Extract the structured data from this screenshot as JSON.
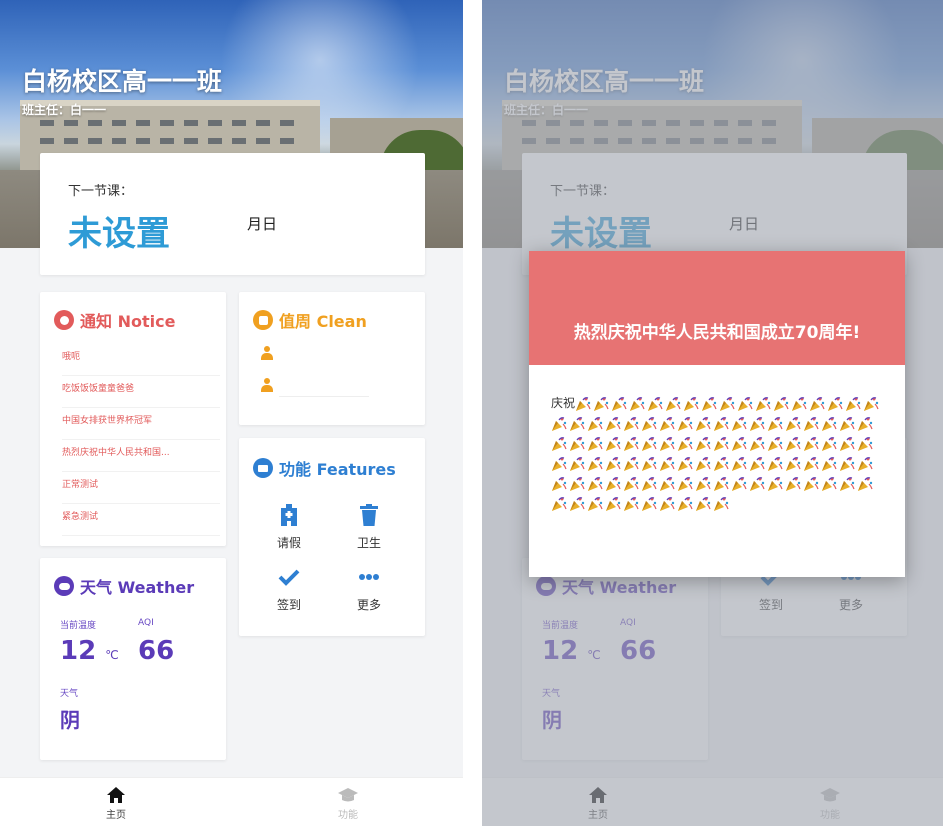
{
  "header": {
    "school_title": "白杨校区高一一班",
    "teacher": "班主任：白一一"
  },
  "next_class": {
    "label": "下一节课：",
    "value": "未设置",
    "date": "月日"
  },
  "notice": {
    "title": "通知 Notice",
    "color": "#e25b5b",
    "items": [
      "哦呃",
      "吃饭饭饭童童爸爸",
      "中国女排获世界杯冠军",
      "热烈庆祝中华人民共和国...",
      "正常测试",
      "紧急测试"
    ]
  },
  "clean": {
    "title": "值周 Clean",
    "color": "#f0a020"
  },
  "features": {
    "title": "功能 Features",
    "color": "#2e7fd2",
    "items": [
      {
        "label": "请假",
        "icon": "hospital-icon"
      },
      {
        "label": "卫生",
        "icon": "trash-icon"
      },
      {
        "label": "签到",
        "icon": "check-icon"
      },
      {
        "label": "更多",
        "icon": "more-icon"
      }
    ]
  },
  "weather": {
    "title": "天气 Weather",
    "color": "#5b3bb8",
    "temp_label": "当前温度",
    "temp_value": "12",
    "temp_unit": "℃",
    "aqi_label": "AQI",
    "aqi_value": "66",
    "cond_label": "天气",
    "cond_value": "阴"
  },
  "nav": {
    "home": "主页",
    "functions": "功能"
  },
  "modal": {
    "title": "热烈庆祝中华人民共和国成立70周年!",
    "body_prefix": "庆祝",
    "party_icon_count": 99
  }
}
